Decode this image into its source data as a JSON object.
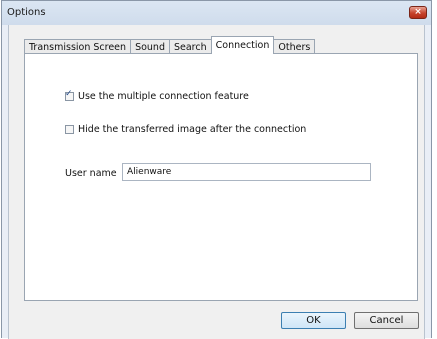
{
  "window": {
    "title": "Options",
    "close_label": "×"
  },
  "tabs": [
    {
      "label": "Transmission Screen",
      "active": false
    },
    {
      "label": "Sound",
      "active": false
    },
    {
      "label": "Search",
      "active": false
    },
    {
      "label": "Connection",
      "active": true
    },
    {
      "label": "Others",
      "active": false
    }
  ],
  "connection": {
    "multiple_connection": {
      "label": "Use the multiple connection feature",
      "checked": true
    },
    "hide_image": {
      "label": "Hide the transferred image after the connection",
      "checked": false
    },
    "user_name": {
      "label": "User name",
      "value": "Alienware"
    }
  },
  "buttons": {
    "ok": "OK",
    "cancel": "Cancel"
  },
  "colors": {
    "close_button": "#c7432d",
    "panel": "#ffffff",
    "window_frame": "#e9eef6"
  },
  "icons": {
    "check": "checkmark-icon",
    "close": "close-icon"
  }
}
